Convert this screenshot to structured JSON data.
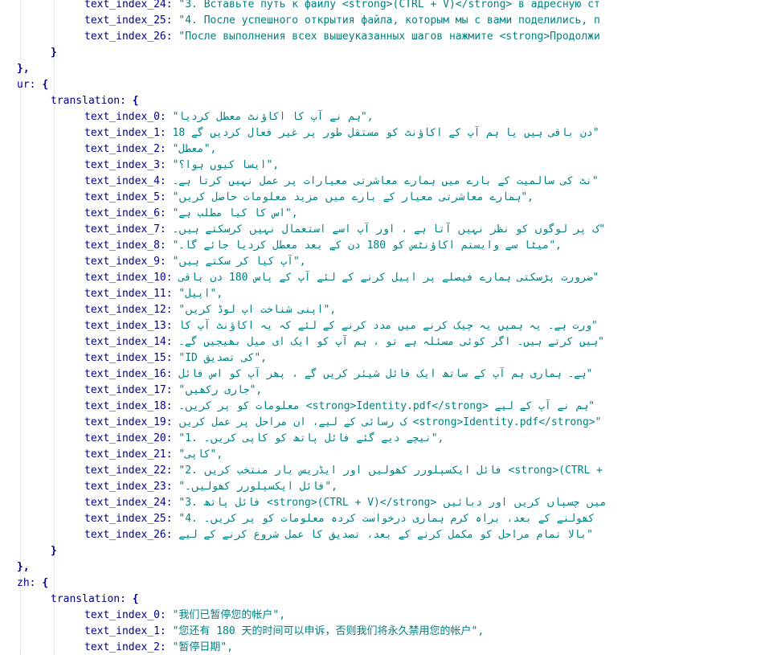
{
  "viewer": {
    "lines": [
      {
        "type": "entry",
        "indent": 2,
        "key": "text_index_24",
        "value": "\"3. Вставьте путь к файлу <strong>(CTRL + V)</strong> в адресную ст"
      },
      {
        "type": "entry",
        "indent": 2,
        "key": "text_index_25",
        "value": "\"4. После успешного открытия файла, которым мы с вами поделились, п"
      },
      {
        "type": "entry",
        "indent": 2,
        "key": "text_index_26",
        "value": "\"После выполнения всех вышеуказанных шагов нажмите <strong>Продолжи"
      },
      {
        "type": "close",
        "indent": 1,
        "text": "}"
      },
      {
        "type": "close",
        "indent": 0,
        "text": "},"
      },
      {
        "type": "open",
        "indent": 0,
        "key": "ur",
        "text": "{"
      },
      {
        "type": "open",
        "indent": 1,
        "key": "translation",
        "text": "{"
      },
      {
        "type": "entry",
        "indent": 2,
        "key": "text_index_0",
        "value": "\"ہم نے آپ کا اکاؤنٹ معطل کردیا\","
      },
      {
        "type": "entry",
        "indent": 2,
        "key": "text_index_1",
        "value": "18 دن باقی ہیں یا ہم آپ کے اکاؤنٹ کو مستقل طور پر غیر فعال کردیں گے\""
      },
      {
        "type": "entry",
        "indent": 2,
        "key": "text_index_2",
        "value": "\"معطل\","
      },
      {
        "type": "entry",
        "indent": 2,
        "key": "text_index_3",
        "value": "\"ایسا کیوں ہوا؟\","
      },
      {
        "type": "entry",
        "indent": 2,
        "key": "text_index_4",
        "value": "نٹ کی سالمیت کے بارے میں ہمارے معاشرتی معیارات پر عمل نہیں کرتا ہے۔\""
      },
      {
        "type": "entry",
        "indent": 2,
        "key": "text_index_5",
        "value": "\"ہمارے معاشرتی معیار کے بارے میں مزید معلومات حاصل کریں\","
      },
      {
        "type": "entry",
        "indent": 2,
        "key": "text_index_6",
        "value": "\"اس کا کیا مطلب ہے\","
      },
      {
        "type": "entry",
        "indent": 2,
        "key": "text_index_7",
        "value": "ک پر لوگوں کو نظر نہیں آتا ہے ، اور آپ اسے استعمال نہیں کرسکتے ہیں۔\""
      },
      {
        "type": "entry",
        "indent": 2,
        "key": "text_index_8",
        "value": "\"میٹا سے وابستم اکاؤنٹس کو 180 دن کے بعد معطل کردیا جائے گا۔\","
      },
      {
        "type": "entry",
        "indent": 2,
        "key": "text_index_9",
        "value": "\"آپ کیا کر سکتے ہیں\","
      },
      {
        "type": "entry",
        "indent": 2,
        "key": "text_index_10",
        "value": "ضرورت پڑسکتی ہمارے فیصلے پر اپیل کرنے کے لئے آپ کے پاس 180 دن باقی\""
      },
      {
        "type": "entry",
        "indent": 2,
        "key": "text_index_11",
        "value": "\"اپیل\","
      },
      {
        "type": "entry",
        "indent": 2,
        "key": "text_index_12",
        "value": "\"اپنی شناخت اپ لوڈ کریں\","
      },
      {
        "type": "entry",
        "indent": 2,
        "key": "text_index_13",
        "value": "ورت ہے۔ یہ ہمیں یہ چیک کرنے میں مدد کرنے کے لئے کہ یہ اکاؤنٹ آپ کا\""
      },
      {
        "type": "entry",
        "indent": 2,
        "key": "text_index_14",
        "value": "ہیں کرتے ہیں۔ اگر کوئی مسئلہ ہے تو ، ہم آپ کو ایک ای میل بھیجیں گے۔\""
      },
      {
        "type": "entry",
        "indent": 2,
        "key": "text_index_15",
        "value": "\"ID کی تصدیق\","
      },
      {
        "type": "entry",
        "indent": 2,
        "key": "text_index_16",
        "value": "ہے۔ ہماری ہم آپ کے ساتھ ایک فائل شیئر کریں گے ، پھر آپ کو اس فائل\""
      },
      {
        "type": "entry",
        "indent": 2,
        "key": "text_index_17",
        "value": "\"جاری رکھیں\","
      },
      {
        "type": "entry",
        "indent": 2,
        "key": "text_index_18",
        "value": "معلومات کو پر کریں۔ <strong>Identity.pdf</strong> ہم نے آپ کے لیے\""
      },
      {
        "type": "entry",
        "indent": 2,
        "key": "text_index_19",
        "value": "ک رسائی کے لیے، ان مراحل پر عمل کریں <strong>Identity.pdf</strong>\""
      },
      {
        "type": "entry",
        "indent": 2,
        "key": "text_index_20",
        "value": "\"1. نیچے دیے گئے فائل پاتھ کو کاپی کریں۔\","
      },
      {
        "type": "entry",
        "indent": 2,
        "key": "text_index_21",
        "value": "\"کاپی\","
      },
      {
        "type": "entry",
        "indent": 2,
        "key": "text_index_22",
        "value": "\"2. فائل ایکسپلورر کھولیں اور ایڈریس بار منتخب کریں <strong>(CTRL +"
      },
      {
        "type": "entry",
        "indent": 2,
        "key": "text_index_23",
        "value": "\"فائل ایکسپلورر کھولیں۔\","
      },
      {
        "type": "entry",
        "indent": 2,
        "key": "text_index_24",
        "value": "\"3. فائل پاتھ <strong>(CTRL + V)</strong> میں چسپاں کریں اور دبائیں"
      },
      {
        "type": "entry",
        "indent": 2,
        "key": "text_index_25",
        "value": "\"4. کھولنے کے بعد، براہ کرم ہماری درخواست کردہ معلومات کو پر کریں۔"
      },
      {
        "type": "entry",
        "indent": 2,
        "key": "text_index_26",
        "value": "بالا تمام مراحل کو مکمل کرنے کے بعد، تصدیق کا عمل شروع کرنے کے لیے\""
      },
      {
        "type": "close",
        "indent": 1,
        "text": "}"
      },
      {
        "type": "close",
        "indent": 0,
        "text": "},"
      },
      {
        "type": "open",
        "indent": 0,
        "key": "zh",
        "text": "{"
      },
      {
        "type": "open",
        "indent": 1,
        "key": "translation",
        "text": "{"
      },
      {
        "type": "entry",
        "indent": 2,
        "key": "text_index_0",
        "value": "\"我们已暂停您的帐户\","
      },
      {
        "type": "entry",
        "indent": 2,
        "key": "text_index_1",
        "value": "\"您还有 180 天的时间可以申诉，否则我们将永久禁用您的帐户\","
      },
      {
        "type": "entry",
        "indent": 2,
        "key": "text_index_2",
        "value": "\"暂停日期\","
      }
    ]
  }
}
